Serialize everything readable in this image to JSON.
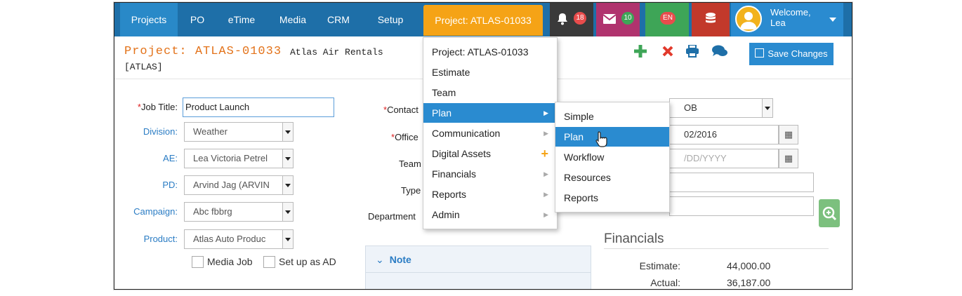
{
  "nav": {
    "items": [
      "Projects",
      "PO",
      "eTime",
      "Media",
      "CRM",
      "Setup"
    ],
    "project_tab": "Project: ATLAS-01033",
    "bell_count": "18",
    "mail_count": "10",
    "lang": "EN",
    "welcome": "Welcome,",
    "user": "Lea",
    "colors": {
      "bar": "#1e6fa8",
      "active": "#2989c8",
      "project_tab": "#f5a316"
    }
  },
  "header": {
    "title": "Project: ATLAS-01033",
    "code": "[ATLAS]",
    "company": "Atlas Air Rentals",
    "save_label": "Save Changes"
  },
  "form": {
    "job_title_label": "Job Title:",
    "job_title_value": "Product Launch",
    "division_label": "Division:",
    "division_value": "Weather",
    "ae_label": "AE:",
    "ae_value": "Lea Victoria Petrel",
    "pd_label": "PD:",
    "pd_value": "Arvind Jag (ARVIN",
    "campaign_label": "Campaign:",
    "campaign_value": "Abc fbbrg",
    "product_label": "Product:",
    "product_value": "Atlas Auto Produc",
    "media_job_label": "Media Job",
    "setup_ad_label": "Set up as AD",
    "contact_label": "Contact",
    "office_label": "Office",
    "team_label": "Team",
    "type_label": "Type",
    "department_label": "Department",
    "right_select_value": "OB",
    "date1_value": "02/2016",
    "date2_placeholder": "/DD/YYYY"
  },
  "menu": {
    "items": [
      {
        "label": "Project: ATLAS-01033",
        "chevron": ""
      },
      {
        "label": "Estimate",
        "chevron": ""
      },
      {
        "label": "Team",
        "chevron": ""
      },
      {
        "label": "Plan",
        "chevron": "▶"
      },
      {
        "label": "Communication",
        "chevron": "▶"
      },
      {
        "label": "Digital Assets",
        "chevron": "+"
      },
      {
        "label": "Financials",
        "chevron": "▶"
      },
      {
        "label": "Reports",
        "chevron": "▶"
      },
      {
        "label": "Admin",
        "chevron": "▶"
      }
    ],
    "active_index": 3
  },
  "submenu": {
    "items": [
      "Simple",
      "Plan",
      "Workflow",
      "Resources",
      "Reports"
    ],
    "active_index": 1
  },
  "note": {
    "label": "Note"
  },
  "financials": {
    "title": "Financials",
    "estimate_label": "Estimate:",
    "estimate_value": "44,000.00",
    "actual_label": "Actual:",
    "actual_value": "36,187.00"
  }
}
